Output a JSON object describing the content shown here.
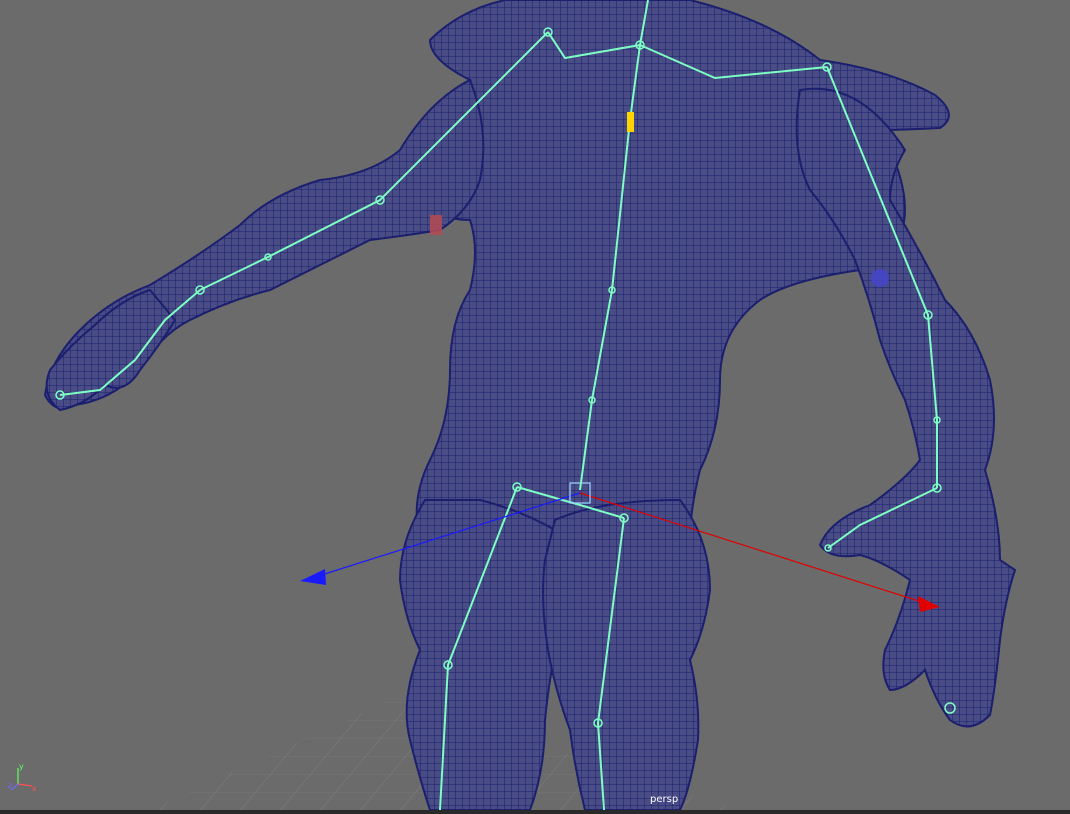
{
  "viewport": {
    "camera_name": "persp",
    "background_color": "#6b6b6b",
    "mesh_color": "#1b1f6e",
    "mesh_fill": "#3a3c7a",
    "skeleton_color": "#7dffc4",
    "grid_color": "#8a8a8a",
    "manipulator": {
      "x_axis_color": "#e00000",
      "z_axis_color": "#1a1aff",
      "y_axis_color": "#ffe000"
    },
    "axis_indicator": {
      "x_label": "x",
      "y_label": "y",
      "z_label": "z",
      "x_color": "#ff5050",
      "y_color": "#60ff60",
      "z_color": "#6a6aff"
    }
  }
}
